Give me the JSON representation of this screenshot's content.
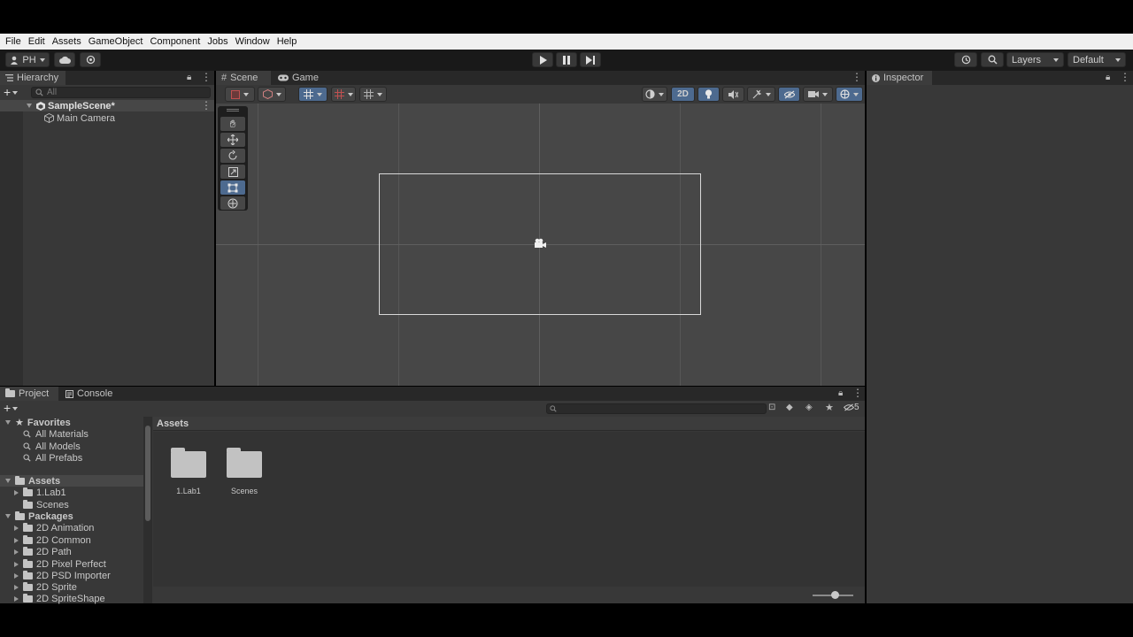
{
  "menu": [
    "File",
    "Edit",
    "Assets",
    "GameObject",
    "Component",
    "Jobs",
    "Window",
    "Help"
  ],
  "toolbar": {
    "account": "PH",
    "layers": "Layers",
    "layout": "Default"
  },
  "hierarchy": {
    "tab": "Hierarchy",
    "search_placeholder": "All",
    "scene": "SampleScene*",
    "objects": [
      "Main Camera"
    ]
  },
  "scene": {
    "tabs": [
      "Scene",
      "Game"
    ],
    "mode_2d": "2D"
  },
  "inspector": {
    "tab": "Inspector"
  },
  "project": {
    "tabs": [
      "Project",
      "Console"
    ],
    "hidden_count": "5",
    "breadcrumb": "Assets",
    "favorites_label": "Favorites",
    "favorites": [
      "All Materials",
      "All Models",
      "All Prefabs"
    ],
    "assets_label": "Assets",
    "assets": [
      "1.Lab1",
      "Scenes"
    ],
    "packages_label": "Packages",
    "packages": [
      "2D Animation",
      "2D Common",
      "2D Path",
      "2D Pixel Perfect",
      "2D PSD Importer",
      "2D Sprite",
      "2D SpriteShape"
    ],
    "grid_items": [
      "1.Lab1",
      "Scenes"
    ]
  },
  "colors": {
    "accent": "#4d6a8f",
    "panel": "#383838",
    "toolbar": "#191919"
  }
}
